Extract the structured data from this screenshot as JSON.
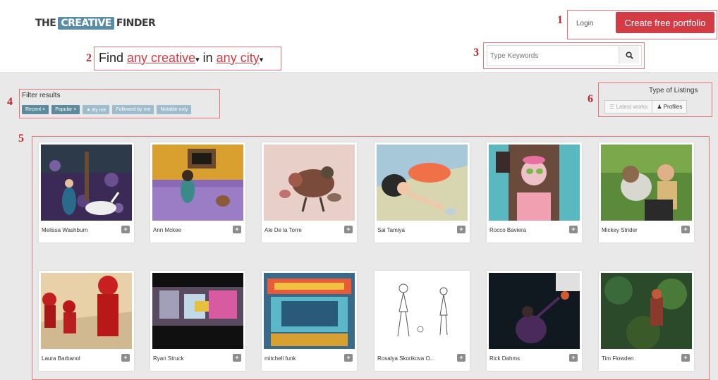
{
  "header": {
    "logo_left": "THE",
    "logo_mid": "CREATIVE",
    "logo_right": "FINDER",
    "login_label": "Login",
    "create_label": "Create free portfolio"
  },
  "find": {
    "prefix": "Find",
    "creative_link": "any creative",
    "connector": "in",
    "city_link": "any city",
    "caret": "▾"
  },
  "search": {
    "placeholder": "Type Keywords"
  },
  "filters": {
    "title": "Filter results",
    "chips": [
      {
        "label": "Recent ×",
        "active": true
      },
      {
        "label": "Popular ×",
        "active": true
      },
      {
        "label": "★ By me",
        "active": false
      },
      {
        "label": "Followed by me",
        "active": false
      },
      {
        "label": "Notable only",
        "active": false
      }
    ]
  },
  "listings": {
    "title": "Type of Listings",
    "latest_label": "☰ Latest works",
    "profiles_label": "♟ Profiles"
  },
  "annotations": [
    "1",
    "2",
    "3",
    "4",
    "5",
    "6"
  ],
  "cards": [
    {
      "name": "Melissa Washburn"
    },
    {
      "name": "Ann Mckee"
    },
    {
      "name": "Ale De la Torre"
    },
    {
      "name": "Sai Tamiya"
    },
    {
      "name": "Rocco Baviera"
    },
    {
      "name": "Mickey Strider"
    },
    {
      "name": "Laura Barbanol"
    },
    {
      "name": "Ryan Struck"
    },
    {
      "name": "mitchell funk"
    },
    {
      "name": "Rosalya Skorikova O..."
    },
    {
      "name": "Rick Dahms"
    },
    {
      "name": "Tim Flowden"
    }
  ],
  "colors": {
    "accent": "#d43c45",
    "annotation": "#c0242c",
    "chip": "#5e8a9e"
  }
}
